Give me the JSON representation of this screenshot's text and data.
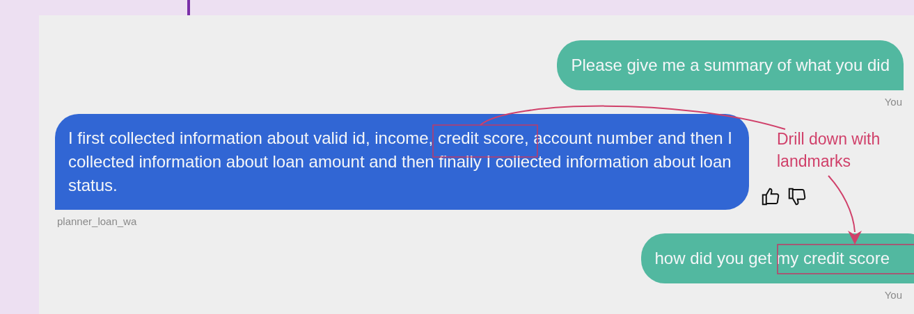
{
  "messages": [
    {
      "kind": "user",
      "text": "Please give me a summary of what you did",
      "author": "You"
    },
    {
      "kind": "bot",
      "text": "I first collected information about valid id, income, credit score, account number and then I collected information about loan amount and then finally I collected information about loan status.",
      "author": "planner_loan_wa"
    },
    {
      "kind": "user",
      "text": "how did you get my credit score",
      "author": "You"
    }
  ],
  "annotation": {
    "note": "Drill down with landmarks"
  }
}
